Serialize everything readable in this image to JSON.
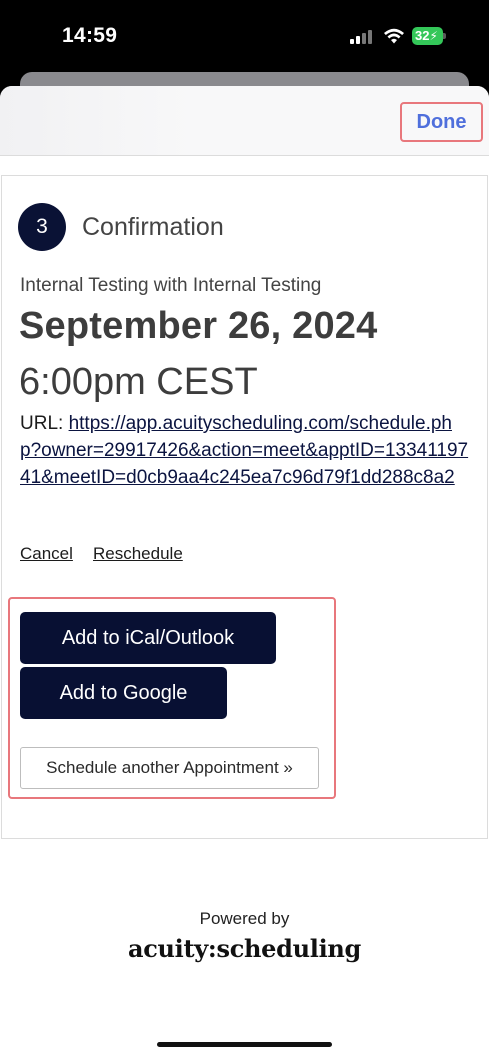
{
  "status_bar": {
    "time": "14:59",
    "battery": "32"
  },
  "header": {
    "done_label": "Done"
  },
  "confirmation": {
    "step_number": "3",
    "step_title": "Confirmation",
    "subtitle": "Internal Testing with Internal Testing",
    "date": "September 26, 2024",
    "time": "6:00pm CEST",
    "url_label": "URL:",
    "url": "https://app.acuityscheduling.com/schedule.php?owner=29917426&action=meet&apptID=1334119741&meetID=d0cb9aa4c245ea7c96d79f1dd288c8a2",
    "cancel_label": "Cancel",
    "reschedule_label": "Reschedule"
  },
  "actions": {
    "ical_label": "Add to iCal/Outlook",
    "google_label": "Add to Google",
    "schedule_another_label": "Schedule another Appointment »"
  },
  "footer": {
    "powered_by": "Powered by",
    "logo_text": "acuity:scheduling"
  },
  "colors": {
    "dark_button": "#081033",
    "highlight_border": "#e8777c",
    "done_text": "#4f6fdc"
  }
}
